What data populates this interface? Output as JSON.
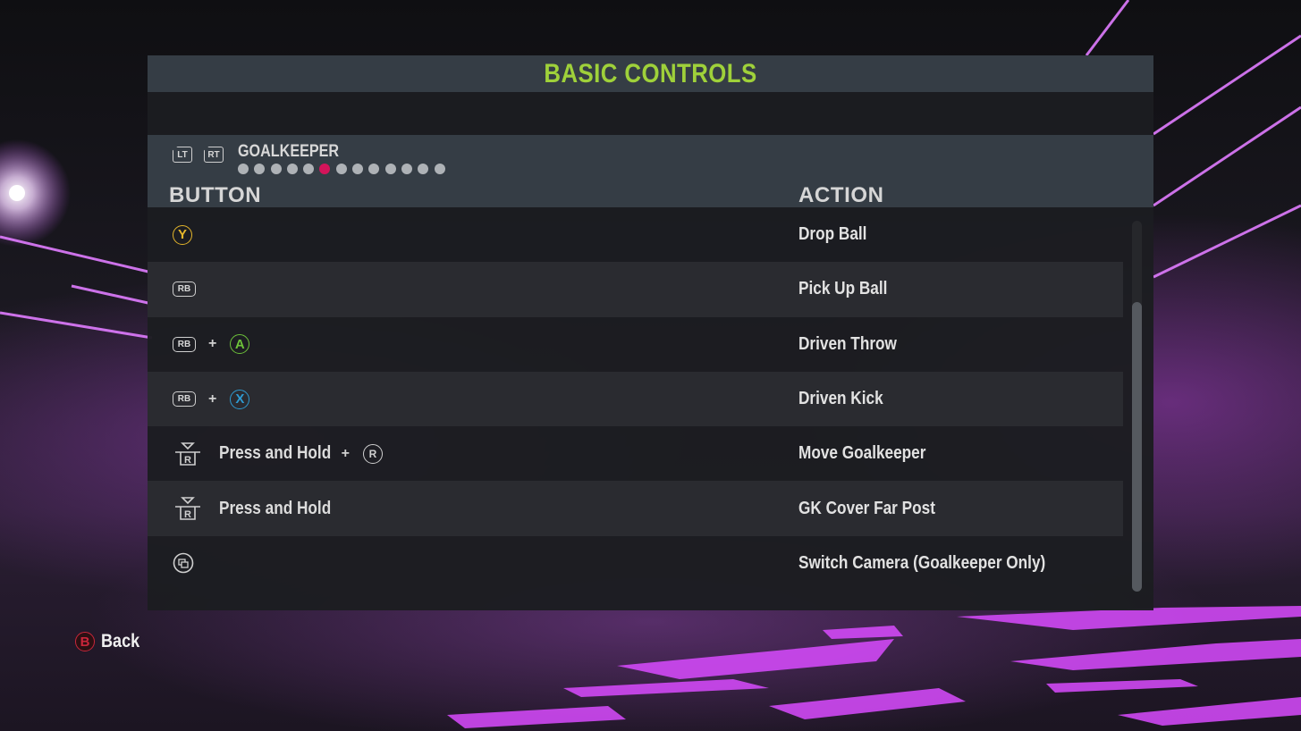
{
  "title": "BASIC CONTROLS",
  "category": {
    "prev_trigger": "LT",
    "next_trigger": "RT",
    "label": "GOALKEEPER",
    "page_count": 13,
    "active_page": 6
  },
  "columns": {
    "button": "BUTTON",
    "action": "ACTION"
  },
  "rows": [
    {
      "keys": [
        "Y"
      ],
      "hold_text": "",
      "action": "Drop Ball"
    },
    {
      "keys": [
        "RB"
      ],
      "hold_text": "",
      "action": "Pick Up Ball"
    },
    {
      "keys": [
        "RB",
        "+",
        "A"
      ],
      "hold_text": "",
      "action": "Driven Throw"
    },
    {
      "keys": [
        "RB",
        "+",
        "X"
      ],
      "hold_text": "",
      "action": "Driven Kick"
    },
    {
      "keys": [
        "R-stick-press",
        "+",
        "R"
      ],
      "hold_text": "Press and Hold",
      "action": "Move Goalkeeper"
    },
    {
      "keys": [
        "R-stick-press"
      ],
      "hold_text": "Press and Hold",
      "action": "GK Cover Far Post"
    },
    {
      "keys": [
        "View"
      ],
      "hold_text": "",
      "action": "Switch Camera (Goalkeeper Only)"
    }
  ],
  "labels": {
    "y": "Y",
    "rb": "RB",
    "a": "A",
    "x": "X",
    "r": "R",
    "plus": "+",
    "b": "B"
  },
  "scrollbar": {
    "position": 0.22,
    "visible_fraction": 0.78
  },
  "footer": {
    "back_key": "B",
    "back_label": "Back"
  },
  "colors": {
    "title": "#9fd13a",
    "active_dot": "#d4145a",
    "y_button": "#e5b62b",
    "a_button": "#6dc23a",
    "x_button": "#2e9ad0",
    "b_button": "#c9263a"
  }
}
